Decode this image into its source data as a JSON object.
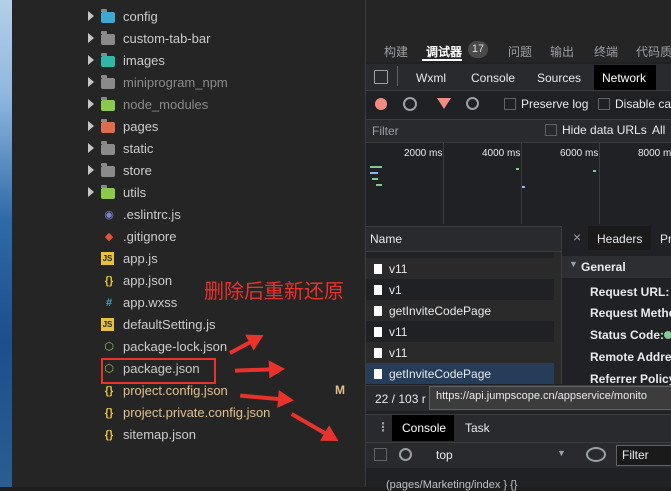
{
  "tree": {
    "items": [
      {
        "label": "config",
        "icon": "folder-config-icon",
        "kind": "folder"
      },
      {
        "label": "custom-tab-bar",
        "icon": "folder-icon",
        "kind": "folder"
      },
      {
        "label": "images",
        "icon": "folder-images-icon",
        "kind": "folder"
      },
      {
        "label": "miniprogram_npm",
        "icon": "folder-icon",
        "kind": "folder",
        "dim": true
      },
      {
        "label": "node_modules",
        "icon": "folder-node-icon",
        "kind": "folder",
        "dim": true
      },
      {
        "label": "pages",
        "icon": "folder-pages-icon",
        "kind": "folder"
      },
      {
        "label": "static",
        "icon": "folder-icon",
        "kind": "folder"
      },
      {
        "label": "store",
        "icon": "folder-icon",
        "kind": "folder"
      },
      {
        "label": "utils",
        "icon": "folder-utils-icon",
        "kind": "folder"
      },
      {
        "label": ".eslintrc.js",
        "icon": "eslint-icon",
        "kind": "file"
      },
      {
        "label": ".gitignore",
        "icon": "git-icon",
        "kind": "file"
      },
      {
        "label": "app.js",
        "icon": "js-icon",
        "kind": "file"
      },
      {
        "label": "app.json",
        "icon": "json-icon",
        "kind": "file"
      },
      {
        "label": "app.wxss",
        "icon": "wxss-icon",
        "kind": "file"
      },
      {
        "label": "defaultSetting.js",
        "icon": "js-icon",
        "kind": "file"
      },
      {
        "label": "package-lock.json",
        "icon": "npm-icon",
        "kind": "file"
      },
      {
        "label": "package.json",
        "icon": "npm-icon",
        "kind": "file"
      },
      {
        "label": "project.config.json",
        "icon": "json-icon",
        "kind": "file",
        "modified": true
      },
      {
        "label": "project.private.config.json",
        "icon": "json-icon",
        "kind": "file",
        "modified": true
      },
      {
        "label": "sitemap.json",
        "icon": "json-icon",
        "kind": "file"
      }
    ],
    "modified_badge": "M"
  },
  "annotation": {
    "text": "删除后重新还原",
    "color": "#e8322b"
  },
  "devtools": {
    "top_tabs": [
      "构建",
      "调试器",
      "问题",
      "输出",
      "终端",
      "代码质"
    ],
    "debugger_count": "17",
    "panel_tabs": [
      "Wxml",
      "Console",
      "Sources",
      "Network"
    ],
    "preserve_log": "Preserve log",
    "disable_cache": "Disable cac",
    "filter_placeholder": "Filter",
    "hide_data_urls": "Hide data URLs",
    "all": "All",
    "ruler": [
      "2000 ms",
      "4000 ms",
      "6000 ms",
      "8000 m"
    ],
    "name_header": "Name",
    "requests": [
      "v11",
      "v1",
      "getInviteCodePage",
      "v11",
      "v11",
      "getInviteCodePage"
    ],
    "detail_tabs": [
      "Headers",
      "Pr"
    ],
    "general": "General",
    "header_keys": [
      "Request URL:",
      "Request Metho",
      "Status Code:",
      "Remote Addre",
      "Referrer Policy"
    ],
    "status_count": "22 / 103 r",
    "tooltip_url": "https://api.jumpscope.cn/appservice/monito",
    "drawer_tabs": [
      "Console",
      "Task"
    ],
    "context": "top",
    "console_filter": "Filter",
    "console_line1": "(pages/Marketing/index } {}",
    "accent": "#1a73e8"
  }
}
